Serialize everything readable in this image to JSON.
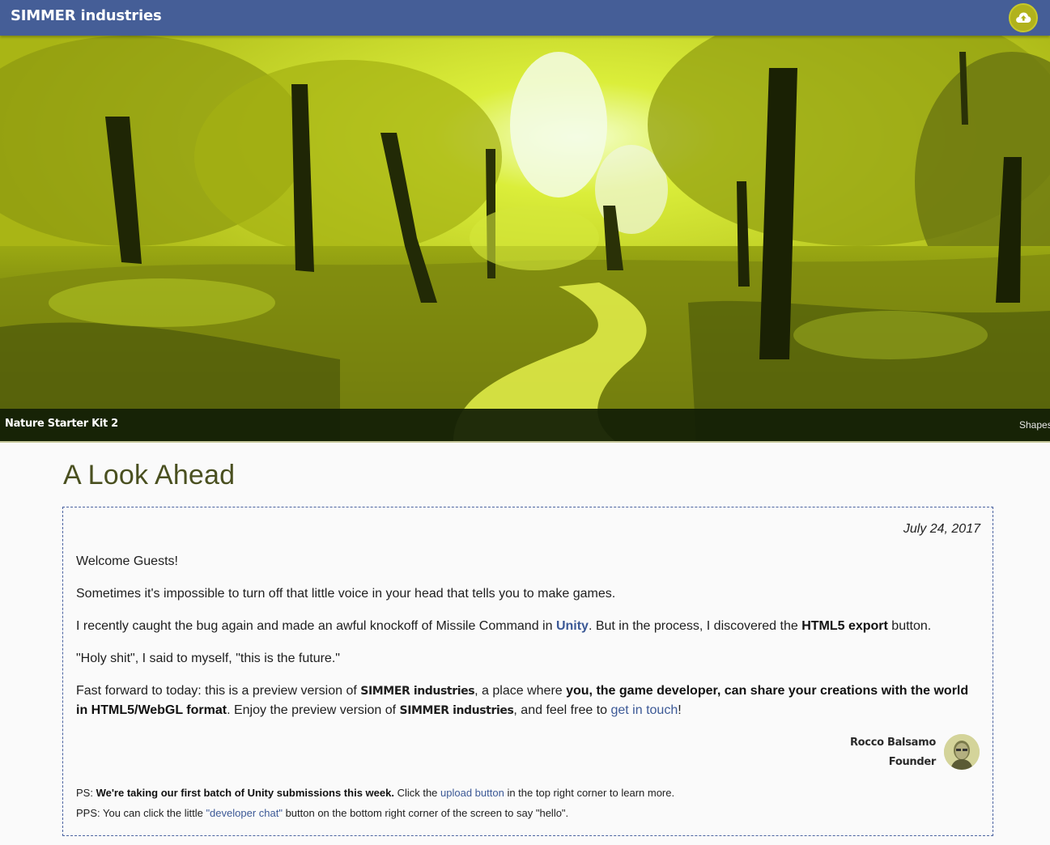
{
  "header": {
    "brand": "SIMMER industries",
    "upload_icon": "cloud-upload-icon",
    "colors": {
      "bar": "#455e97",
      "upload_button": "#b1b21c"
    }
  },
  "hero": {
    "caption_title": "Nature Starter Kit 2",
    "caption_right": "Shapes",
    "image_tone": "#cfe02a"
  },
  "post": {
    "title": "A Look Ahead",
    "date": "July 24, 2017",
    "p1": "Welcome Guests!",
    "p2": "Sometimes it's impossible to turn off that little voice in your head that tells you to make games.",
    "p3_a": "I recently caught the bug again and made an awful knockoff of Missile Command in ",
    "p3_link": "Unity",
    "p3_b": ". But in the process, I discovered the ",
    "p3_bold": "HTML5 export",
    "p3_c": " button.",
    "p4": "\"Holy shit\", I said to myself, \"this is the future.\"",
    "p5_a": "Fast forward to today: this is a preview version of ",
    "p5_brand1": "SIMMER industries",
    "p5_b": ", a place where ",
    "p5_bold": "you, the game developer, can share your creations with the world in HTML5/WebGL format",
    "p5_c": ". Enjoy the preview version of ",
    "p5_brand2": "SIMMER industries",
    "p5_d": ", and feel free to ",
    "p5_link": "get in touch",
    "p5_e": "!",
    "signature_name": "Rocco Balsamo",
    "signature_role": "Founder",
    "ps_label": "PS: ",
    "ps_bold": "We're taking our first batch of Unity submissions this week.",
    "ps_a": " Click the ",
    "ps_link": "upload button",
    "ps_b": " in the top right corner to learn more.",
    "pps_a": "PPS: You can click the little ",
    "pps_link": "\"developer chat\"",
    "pps_b": " button on the bottom right corner of the screen to say \"hello\".",
    "colors": {
      "link": "#3c5996",
      "border": "#4b63a0",
      "title": "#4a5020"
    }
  }
}
